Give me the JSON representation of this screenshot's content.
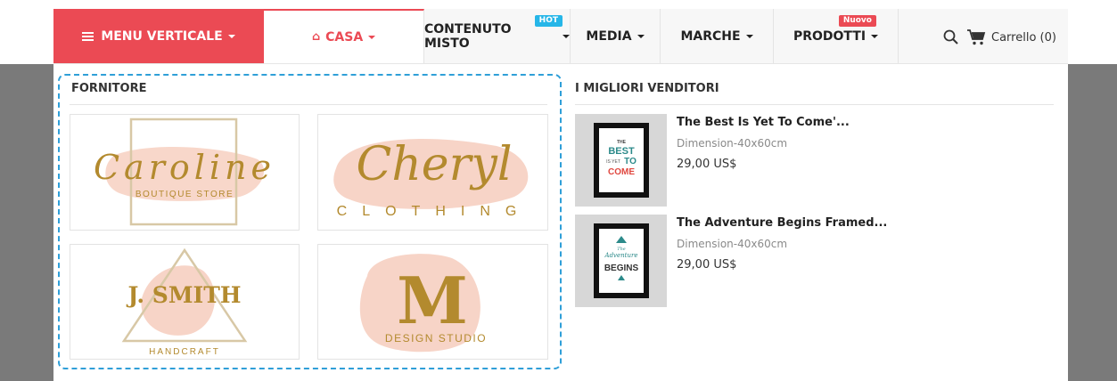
{
  "nav": {
    "menu_verticale": "MENU VERTICALE",
    "casa": "CASA",
    "contenuto_misto": "CONTENUTO MISTO",
    "hot_badge": "HOT",
    "media": "MEDIA",
    "marche": "MARCHE",
    "prodotti": "PRODOTTI",
    "nuovo_badge": "Nuovo",
    "cart": "Carrello (0)"
  },
  "colors": {
    "accent": "#eb4a54",
    "hot": "#26b6e8",
    "gold": "#b38a2e",
    "peach": "#f6cdbd"
  },
  "fornitore": {
    "title": "FORNITORE",
    "brands": {
      "caroline": {
        "name": "Caroline",
        "sub": "BOUTIQUE STORE"
      },
      "cheryl": {
        "name": "Cheryl",
        "sub": "CLOTHING"
      },
      "jsmith": {
        "name": "J. SMITH",
        "sub": "HANDCRAFT"
      },
      "m": {
        "name": "M",
        "sub": "DESIGN STUDIO"
      }
    }
  },
  "bestsellers": {
    "title": "I MIGLIORI VENDITORI",
    "products": [
      {
        "name": "The Best Is Yet To Come'...",
        "dimension": "Dimension-40x60cm",
        "price": "29,00 US$",
        "poster": {
          "l1": "THE",
          "l2": "BEST",
          "l3": "IS YET",
          "l4": "TO",
          "l5": "COME"
        }
      },
      {
        "name": "The Adventure Begins Framed...",
        "dimension": "Dimension-40x60cm",
        "price": "29,00 US$",
        "poster": {
          "l1": "The",
          "l2": "Adventure",
          "l3": "BEGINS"
        }
      }
    ]
  }
}
